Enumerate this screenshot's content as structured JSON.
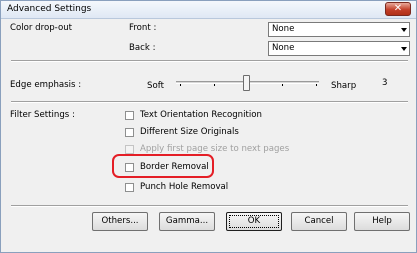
{
  "window": {
    "title": "Advanced Settings"
  },
  "color_dropout": {
    "label": "Color drop-out",
    "front_label": "Front :",
    "front_value": "None",
    "back_label": "Back :",
    "back_value": "None"
  },
  "edge_emphasis": {
    "label": "Edge emphasis :",
    "soft_label": "Soft",
    "sharp_label": "Sharp",
    "value": "3",
    "level": 3,
    "min": 1,
    "max": 5
  },
  "filter_settings": {
    "label": "Filter Settings :",
    "options": [
      {
        "label": "Text Orientation Recognition",
        "checked": false,
        "enabled": true
      },
      {
        "label": "Different Size Originals",
        "checked": false,
        "enabled": true
      },
      {
        "label": "Apply first page size to next pages",
        "checked": false,
        "enabled": false
      },
      {
        "label": "Border Removal",
        "checked": false,
        "enabled": true
      },
      {
        "label": "Punch Hole Removal",
        "checked": false,
        "enabled": true
      }
    ]
  },
  "buttons": {
    "others": "Others...",
    "gamma": "Gamma...",
    "ok": "OK",
    "cancel": "Cancel",
    "help": "Help"
  },
  "colors": {
    "highlight": "#e41e26",
    "close_button": "#c3402a"
  }
}
